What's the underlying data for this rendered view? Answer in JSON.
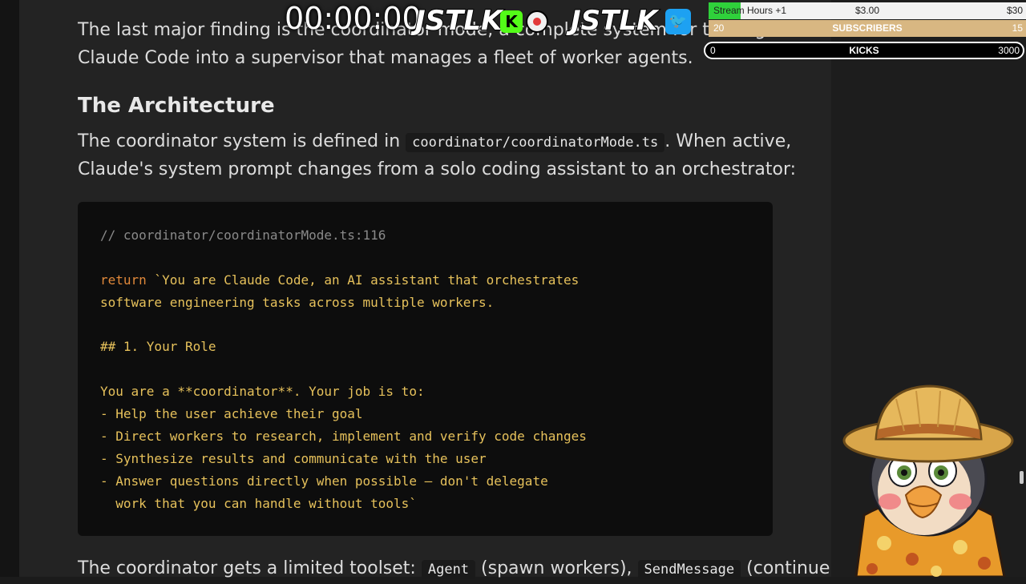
{
  "article": {
    "intro": "The last major finding is the coordinator mode, a complete system for turning Claude Code into a supervisor that manages a fleet of worker agents.",
    "intro_line1": "The last major finding is the coordinator mode, a complete system for turning",
    "intro_line2": "Claude Code into a supervisor that manages a fleet of worker agents.",
    "heading": "The Architecture",
    "p2_a": "The coordinator system is defined in",
    "p2_code": "coordinator/coordinatorMode.ts",
    "p2_b": ". When active,",
    "p2_line2": "Claude's system prompt changes from a solo coding assistant to an orchestrator:",
    "code": {
      "comment": "// coordinator/coordinatorMode.ts:116",
      "kw": "return",
      "l1": " `You are Claude Code, an AI assistant that orchestrates",
      "l2": "software engineering tasks across multiple workers.",
      "l3": "## 1. Your Role",
      "l4": "You are a **coordinator**. Your job is to:",
      "l5": "- Help the user achieve their goal",
      "l6": "- Direct workers to research, implement and verify code changes",
      "l7": "- Synthesize results and communicate with the user",
      "l8": "- Answer questions directly when possible — don't delegate",
      "l9": "  work that you can handle without tools`"
    },
    "p3_a": "The coordinator gets a limited toolset:",
    "p3_code1": "Agent",
    "p3_b": "(spawn workers),",
    "p3_code2": "SendMessage",
    "p3_c": "(continue"
  },
  "overlay": {
    "timer": "00:00:00",
    "logo1": "JSTLK",
    "kick_letter": "K",
    "logo2": "JSTLK",
    "twitter_glyph": "🐦",
    "stream_hours": {
      "label": "Stream Hours +1",
      "amount": "$3.00",
      "goal": "$30",
      "progress": 0.1
    },
    "subscribers": {
      "left": "20",
      "label": "SUBSCRIBERS",
      "right": "15"
    },
    "kicks": {
      "left": "0",
      "label": "KICKS",
      "right": "3000"
    }
  },
  "colors": {
    "background": "#232323",
    "code_bg": "#0d0d0d",
    "keyword": "#e0883a",
    "string": "#e6c15b",
    "comment": "#8a8a8a",
    "hours_bar": "#2fd13b",
    "subs_bar": "#d8b782"
  }
}
